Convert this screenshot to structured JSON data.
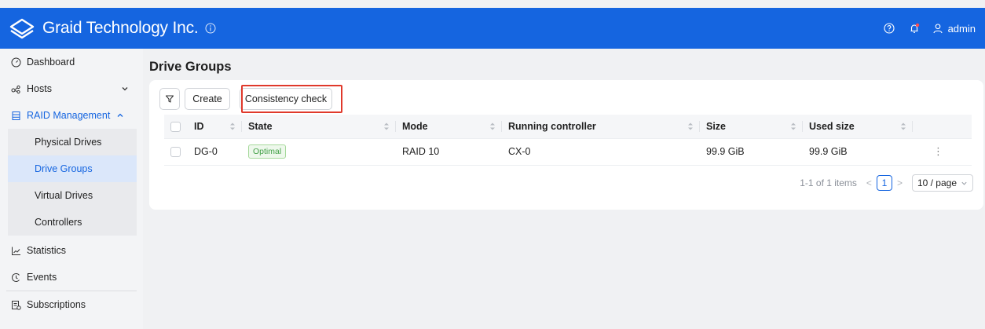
{
  "header": {
    "brand": "Graid Technology Inc.",
    "user": "admin",
    "accent_color": "#1565e0"
  },
  "sidebar": {
    "items": [
      {
        "label": "Dashboard",
        "icon": "dashboard-icon"
      },
      {
        "label": "Hosts",
        "icon": "hosts-icon",
        "expandable": true
      },
      {
        "label": "RAID Management",
        "icon": "raid-icon",
        "expanded": true,
        "children": [
          "Physical Drives",
          "Drive Groups",
          "Virtual Drives",
          "Controllers"
        ],
        "selected": "Drive Groups"
      },
      {
        "label": "Statistics",
        "icon": "chart-icon"
      },
      {
        "label": "Events",
        "icon": "events-icon"
      },
      {
        "label": "Subscriptions",
        "icon": "subscriptions-icon"
      }
    ]
  },
  "main": {
    "title": "Drive Groups",
    "toolbar": {
      "create_label": "Create",
      "check_label": "Consistency check"
    },
    "table": {
      "columns": [
        "ID",
        "State",
        "Mode",
        "Running controller",
        "Size",
        "Used size"
      ],
      "rows": [
        {
          "id": "DG-0",
          "state": "Optimal",
          "mode": "RAID 10",
          "controller": "CX-0",
          "size": "99.9 GiB",
          "used": "99.9 GiB"
        }
      ]
    },
    "pagination": {
      "summary": "1-1 of 1 items",
      "current_page": "1",
      "page_size": "10 / page"
    }
  }
}
